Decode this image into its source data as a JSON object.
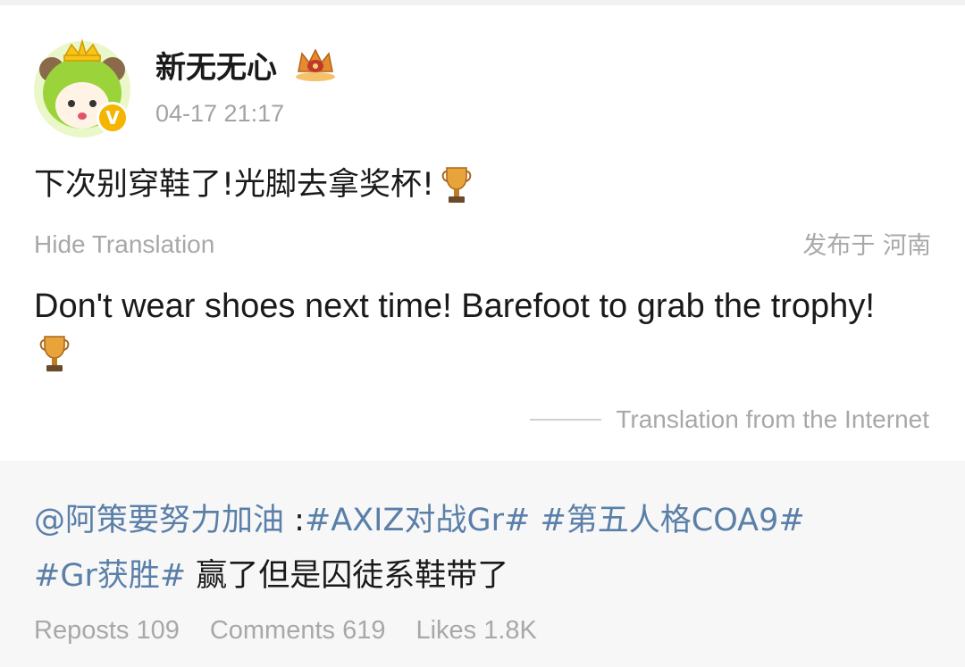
{
  "post": {
    "username": "新无无心",
    "timestamp": "04-17 21:17",
    "text": "下次别穿鞋了!光脚去拿奖杯!",
    "hide_translation": "Hide Translation",
    "location": "发布于 河南",
    "translated_text": "Don't wear shoes next time! Barefoot to grab the trophy!",
    "translation_note": "Translation from the Internet",
    "icons": {
      "avatar": "avatar-icon",
      "verified": "verified-badge-icon",
      "crown": "crown-badge-icon",
      "trophy": "trophy-icon"
    },
    "verified_mark": "V"
  },
  "quoted": {
    "mention": "@阿策要努力加油",
    "separator": " :",
    "tags": [
      "#AXIZ对战Gr#",
      "#第五人格COA9#",
      "#Gr获胜#"
    ],
    "tail_text": " 赢了但是囚徒系鞋带了"
  },
  "stats": {
    "reposts": "Reposts 109",
    "comments": "Comments 619",
    "likes": "Likes 1.8K"
  },
  "colors": {
    "link": "#5a7fa8",
    "muted": "#a8a8a8",
    "verified": "#f5b400",
    "quoted_bg": "#f7f7f7"
  }
}
